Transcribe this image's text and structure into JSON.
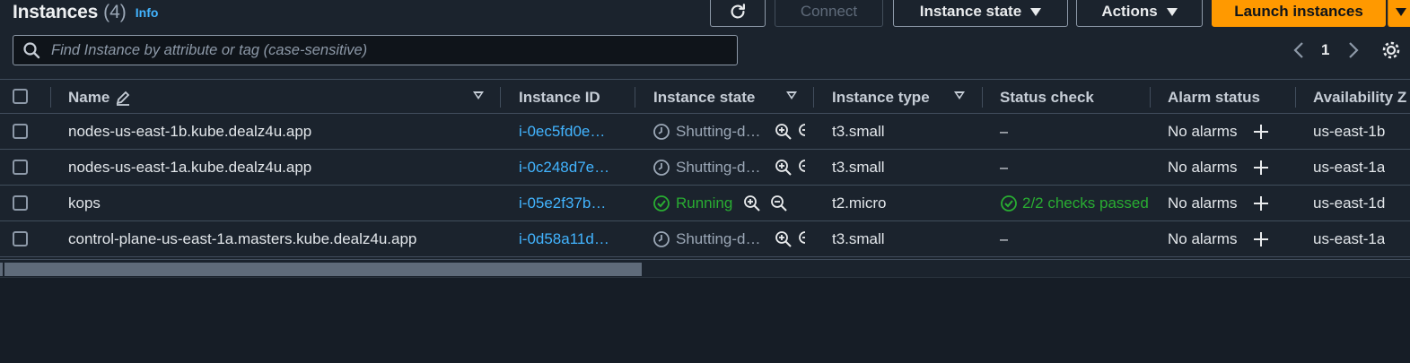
{
  "header": {
    "title": "Instances",
    "count": "(4)",
    "info_label": "Info"
  },
  "toolbar": {
    "refresh_icon": "refresh-icon",
    "connect_label": "Connect",
    "instance_state_label": "Instance state",
    "actions_label": "Actions",
    "launch_label": "Launch instances"
  },
  "search": {
    "placeholder": "Find Instance by attribute or tag (case-sensitive)"
  },
  "pagination": {
    "current_page": "1"
  },
  "columns": {
    "name": "Name",
    "instance_id": "Instance ID",
    "instance_state": "Instance state",
    "instance_type": "Instance type",
    "status_check": "Status check",
    "alarm_status": "Alarm status",
    "availability_zone": "Availability Z"
  },
  "rows": [
    {
      "name": "nodes-us-east-1b.kube.dealz4u.app",
      "instance_id": "i-0ec5fd0e…",
      "state": "Shutting-d…",
      "type": "t3.small",
      "status_check": "–",
      "alarm": "No alarms",
      "az": "us-east-1b"
    },
    {
      "name": "nodes-us-east-1a.kube.dealz4u.app",
      "instance_id": "i-0c248d7e…",
      "state": "Shutting-d…",
      "type": "t3.small",
      "status_check": "–",
      "alarm": "No alarms",
      "az": "us-east-1a"
    },
    {
      "name": "kops",
      "instance_id": "i-05e2f37b…",
      "state": "Running",
      "type": "t2.micro",
      "status_check": "2/2 checks passed",
      "alarm": "No alarms",
      "az": "us-east-1d"
    },
    {
      "name": "control-plane-us-east-1a.masters.kube.dealz4u.app",
      "instance_id": "i-0d58a11d…",
      "state": "Shutting-d…",
      "type": "t3.small",
      "status_check": "–",
      "alarm": "No alarms",
      "az": "us-east-1a"
    }
  ],
  "colors": {
    "accent": "#ff9900",
    "link": "#42b4ff",
    "success": "#29ad32",
    "background": "#161d26"
  }
}
